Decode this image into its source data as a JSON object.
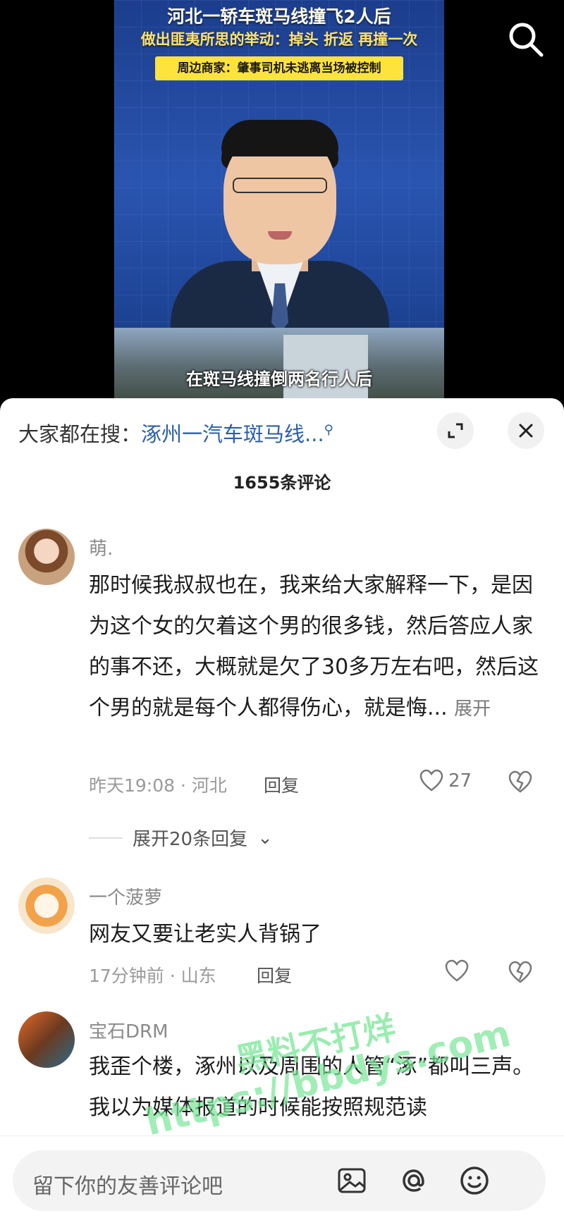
{
  "video": {
    "headline_1": "河北一轿车斑马线撞飞2人后",
    "headline_2": "做出匪夷所思的举动：掉头 折返 再撞一次",
    "headline_3": "周边商家：肇事司机未逃离当场被控制",
    "caption": "在斑马线撞倒两名行人后"
  },
  "sheet": {
    "search_prefix": "大家都在搜：",
    "search_term": "涿州一汽车斑马线...",
    "comment_count": "1655条评论"
  },
  "comments": [
    {
      "user": "萌.",
      "text": "那时候我叔叔也在，我来给大家解释一下，是因为这个女的欠着这个男的很多钱，然后答应人家的事不还，大概就是欠了30多万左右吧，然后这个男的就是每个人都得伤心，就是悔...",
      "more": "展开",
      "meta": "昨天19:08 · 河北",
      "reply": "回复",
      "likes": "27",
      "expand_replies": "展开20条回复"
    },
    {
      "user": "一个菠萝",
      "text": "网友又要让老实人背锅了",
      "meta": "17分钟前 · 山东",
      "reply": "回复"
    },
    {
      "user": "宝石DRM",
      "text": "我歪个楼，涿州以及周围的人管“涿”都叫三声。我以为媒体报道的时候能按照规范读"
    }
  ],
  "watermark": {
    "line1": "黑料不打烊",
    "line2": "https://bbdys.com"
  },
  "input": {
    "placeholder": "留下你的友善评论吧"
  },
  "icons": [
    "search-icon",
    "expand-icon",
    "close-icon",
    "heart-icon",
    "dislike-icon",
    "image-icon",
    "at-icon",
    "emoji-icon",
    "chevron-down-icon"
  ],
  "colors": {
    "link_blue": "#2c5ea8",
    "headline_yellow": "#ffe33d",
    "watermark_green": "#78e696"
  }
}
